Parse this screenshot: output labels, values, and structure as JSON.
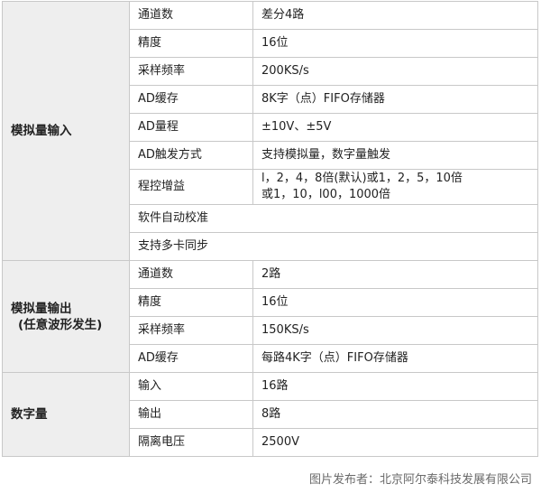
{
  "groups": [
    {
      "title_lines": [
        "模拟量输入"
      ],
      "rows": [
        {
          "label": "通道数",
          "value": "差分4路"
        },
        {
          "label": "精度",
          "value": "16位"
        },
        {
          "label": "采样频率",
          "value": "200KS/s"
        },
        {
          "label": "AD缓存",
          "value": "8K字（点）FIFO存储器"
        },
        {
          "label": "AD量程",
          "value": "±10V、±5V"
        },
        {
          "label": "AD触发方式",
          "value": "支持模拟量，数字量触发"
        },
        {
          "label": "程控增益",
          "value_lines": [
            "l，2，4，8倍(默认)或1，2，5，10倍",
            "或1，10，l00，1000倍"
          ]
        },
        {
          "label": "软件自动校准"
        },
        {
          "label": "支持多卡同步"
        }
      ]
    },
    {
      "title_lines": [
        "模拟量输出",
        "(任意波形发生)"
      ],
      "rows": [
        {
          "label": "通道数",
          "value": "2路"
        },
        {
          "label": "精度",
          "value": "16位"
        },
        {
          "label": "采样频率",
          "value": "150KS/s"
        },
        {
          "label": "AD缓存",
          "value": "每路4K字（点）FIFO存储器"
        }
      ]
    },
    {
      "title_lines": [
        "数字量"
      ],
      "rows": [
        {
          "label": "输入",
          "value": "16路"
        },
        {
          "label": "输出",
          "value": "8路"
        },
        {
          "label": "隔离电压",
          "value": "2500V"
        }
      ]
    }
  ],
  "caption": "图片发布者：北京阿尔泰科技发展有限公司"
}
